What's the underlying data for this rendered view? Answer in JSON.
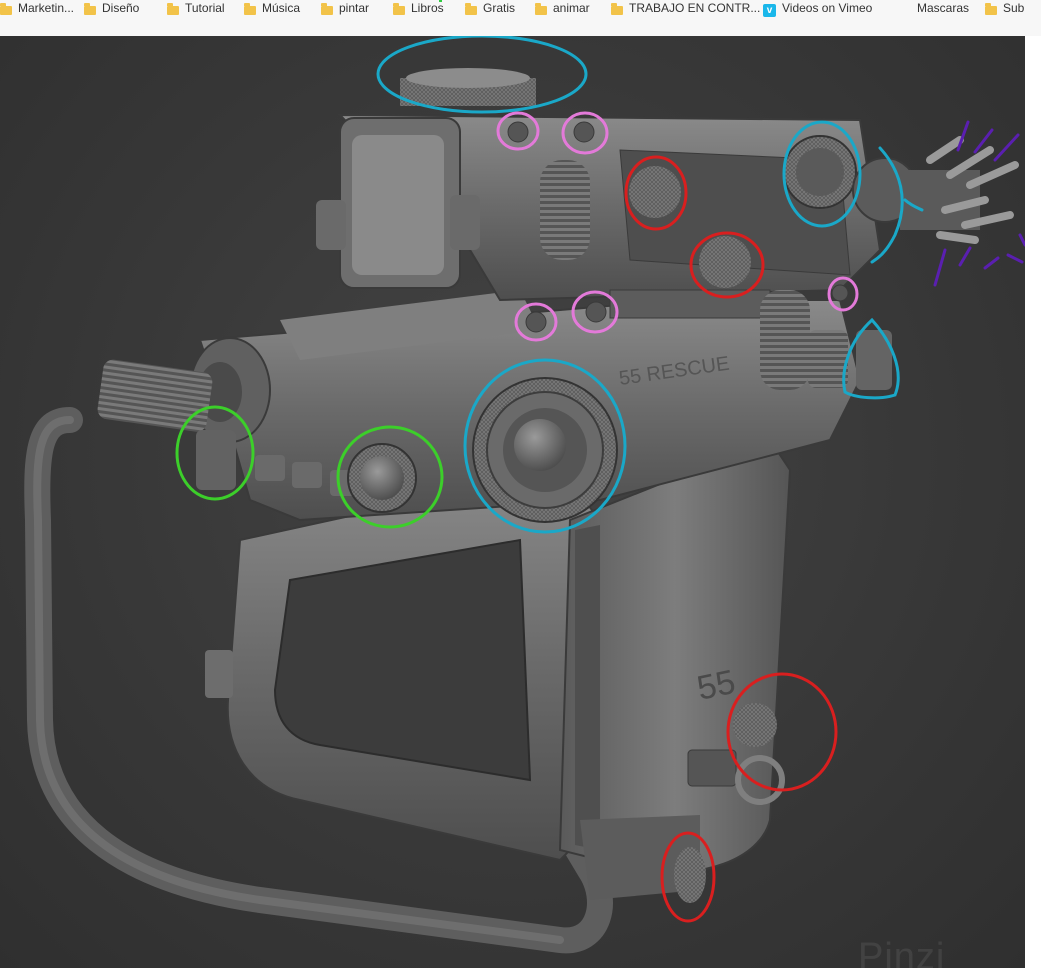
{
  "bookmarks": [
    {
      "label": "Marketin...",
      "icon": "folder-icon"
    },
    {
      "label": "Diseño",
      "icon": "folder-icon"
    },
    {
      "label": "Tutorial",
      "icon": "folder-icon"
    },
    {
      "label": "Música",
      "icon": "folder-icon"
    },
    {
      "label": "pintar",
      "icon": "folder-icon"
    },
    {
      "label": "Libros",
      "icon": "folder-icon"
    },
    {
      "label": "Gratis",
      "icon": "folder-icon"
    },
    {
      "label": "animar",
      "icon": "folder-icon"
    },
    {
      "label": "TRABAJO EN CONTR...",
      "icon": "folder-icon"
    },
    {
      "label": "Videos on Vimeo",
      "icon": "vimeo-icon"
    },
    {
      "label": "Mascaras",
      "icon": "none"
    },
    {
      "label": "Sub",
      "icon": "folder-icon"
    }
  ],
  "model_labels": {
    "barrel_engraving": "55 RESCUE",
    "grip_number": "55"
  },
  "watermark": "Pinzi",
  "annotation_colors": {
    "cyan": "#1aa8c8",
    "pink": "#e37ad9",
    "red": "#d91f1f",
    "green": "#3ccf2a",
    "purple": "#5a1fb0"
  }
}
